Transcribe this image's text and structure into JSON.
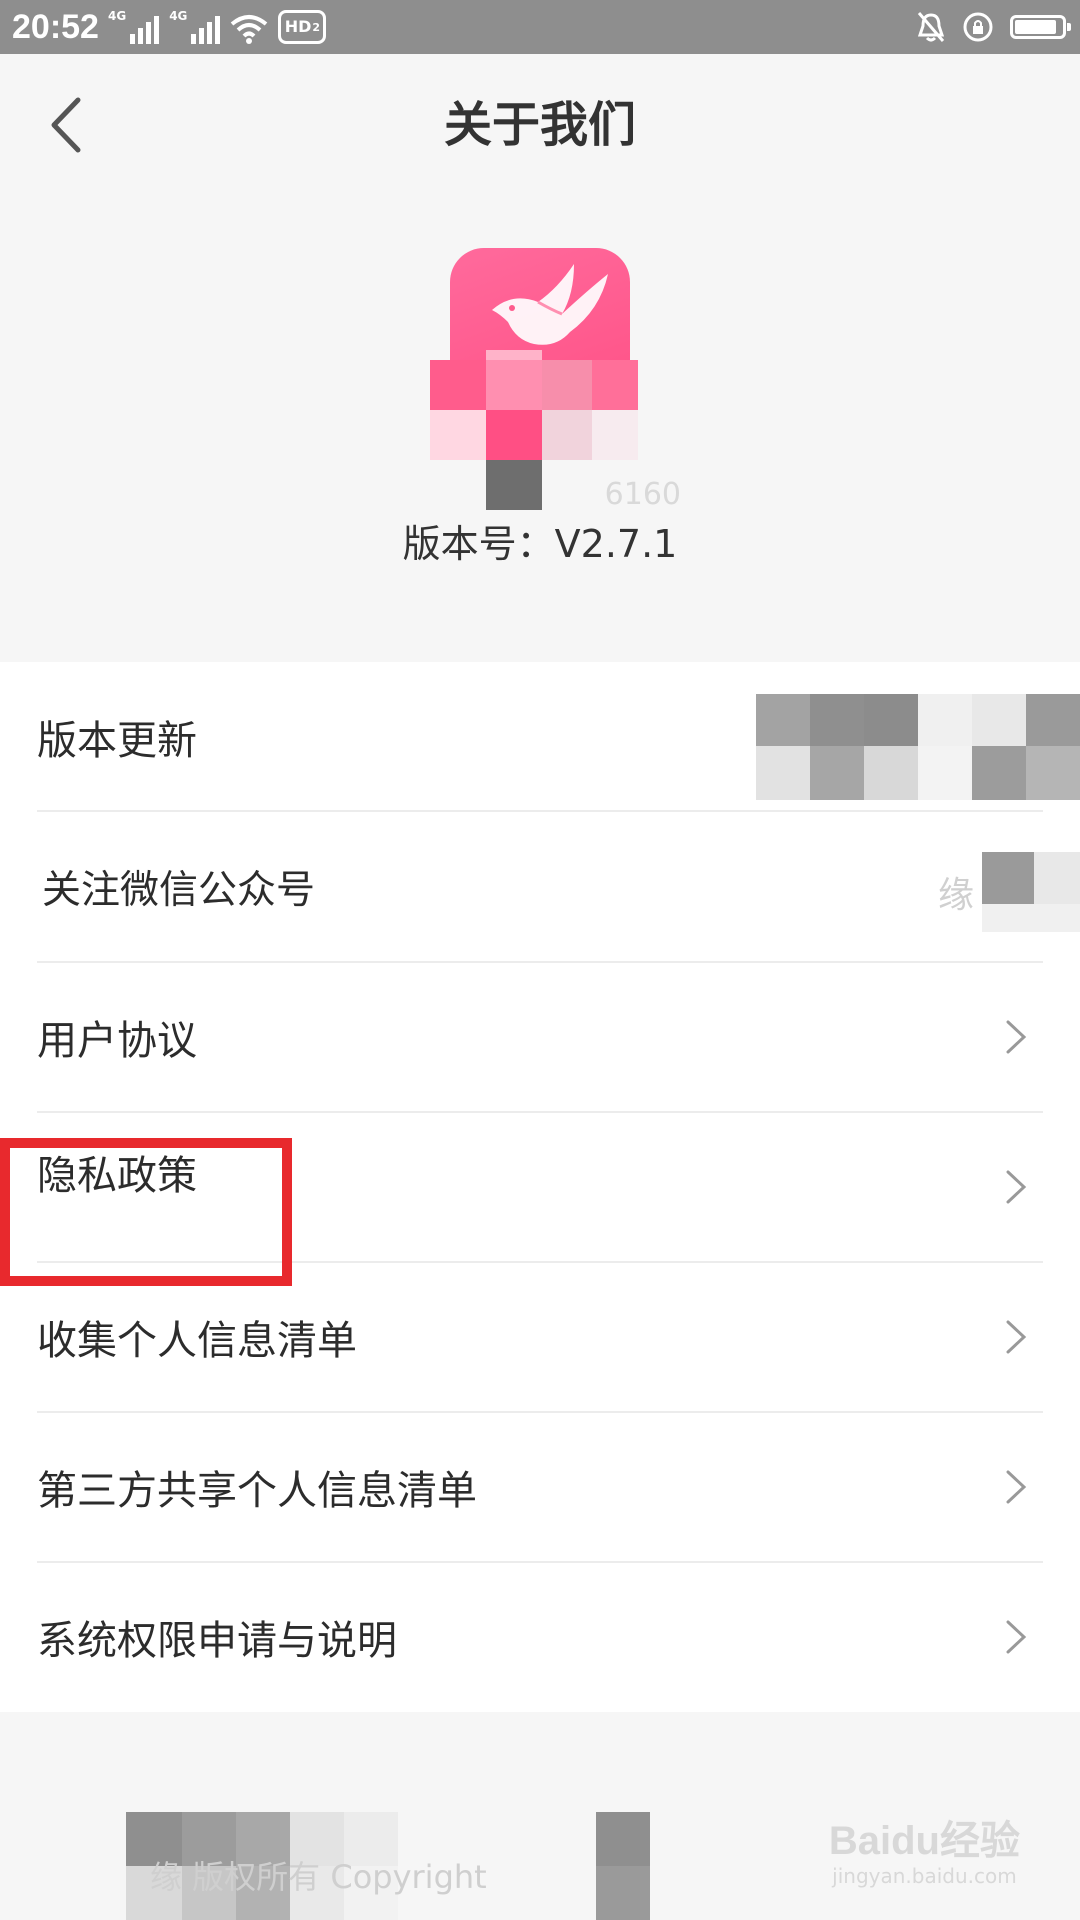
{
  "status_bar": {
    "time": "20:52",
    "network_1": "4G",
    "network_2": "4G",
    "hd_label": "HD",
    "hd_sub": "2",
    "battery_level": 0.9
  },
  "header": {
    "title": "关于我们",
    "back_icon": "chevron-left-icon"
  },
  "app": {
    "logo_icon": "bird-logo-icon",
    "logo_color": "#ff5a8c",
    "blurred_text": "6160",
    "version_label": "版本号：V2.7.1"
  },
  "menu": {
    "items": [
      {
        "label": "版本更新",
        "chevron": false
      },
      {
        "label": "关注微信公众号",
        "chevron": false,
        "trailing_text": "缘"
      },
      {
        "label": "用户协议",
        "chevron": true
      },
      {
        "label": "隐私政策",
        "chevron": true,
        "highlighted": true
      },
      {
        "label": "收集个人信息清单",
        "chevron": true
      },
      {
        "label": "第三方共享个人信息清单",
        "chevron": true
      },
      {
        "label": "系统权限申请与说明",
        "chevron": true
      }
    ]
  },
  "footer": {
    "text": "缘       版权所有 Copyright"
  },
  "watermark": {
    "main": "Baidu经验",
    "sub": "jingyan.baidu.com"
  },
  "colors": {
    "status_bar": "#8e8e8e",
    "highlight": "#e8292d",
    "background": "#f6f6f6"
  }
}
